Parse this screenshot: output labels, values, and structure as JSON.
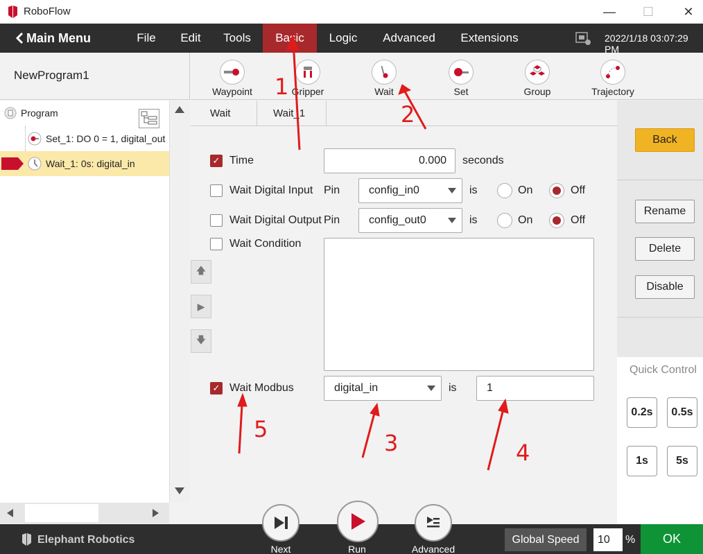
{
  "app": {
    "title": "RoboFlow"
  },
  "window": {
    "minimize": "—",
    "maximize": "☐",
    "close": "✕"
  },
  "menu": {
    "main_menu": "Main Menu",
    "items": [
      "File",
      "Edit",
      "Tools",
      "Basic",
      "Logic",
      "Advanced",
      "Extensions"
    ],
    "datetime": "2022/1/18 03:07:29 PM"
  },
  "program": {
    "name": "NewProgram1",
    "tree": [
      {
        "label": "Program"
      },
      {
        "label": "Set_1: DO 0 = 1, digital_out"
      },
      {
        "label": "Wait_1: 0s: digital_in"
      }
    ]
  },
  "toolbar": {
    "items": [
      "Waypoint",
      "Gripper",
      "Wait",
      "Set",
      "Group",
      "Trajectory"
    ]
  },
  "tabs": [
    "Wait",
    "Wait_1"
  ],
  "wait_form": {
    "time": {
      "label": "Time",
      "checked": true,
      "value": "0.000",
      "unit": "seconds"
    },
    "digital_input": {
      "label": "Wait Digital Input",
      "pin_label": "Pin",
      "pin": "config_in0",
      "is": "is",
      "on": "On",
      "off": "Off",
      "selected": "Off"
    },
    "digital_output": {
      "label": "Wait Digital Output",
      "pin_label": "Pin",
      "pin": "config_out0",
      "is": "is",
      "on": "On",
      "off": "Off",
      "selected": "Off"
    },
    "condition": {
      "label": "Wait Condition",
      "value": ""
    },
    "modbus": {
      "label": "Wait Modbus",
      "checked": true,
      "signal": "digital_in",
      "is": "is",
      "value": "1"
    }
  },
  "right": {
    "back": "Back",
    "rename": "Rename",
    "delete": "Delete",
    "disable": "Disable",
    "quick_control": "Quick Control",
    "quick": [
      "0.2s",
      "0.5s",
      "1s",
      "5s"
    ]
  },
  "footer": {
    "brand": "Elephant Robotics",
    "next": "Next",
    "run": "Run",
    "advanced": "Advanced",
    "speed_label": "Global Speed",
    "speed_value": "10",
    "percent": "%",
    "ok": "OK"
  },
  "annotations": [
    "1",
    "2",
    "3",
    "4",
    "5"
  ],
  "colors": {
    "accent": "#a8292c",
    "back": "#f0b323",
    "ok": "#0e9436",
    "annotation": "#e01b1b"
  }
}
